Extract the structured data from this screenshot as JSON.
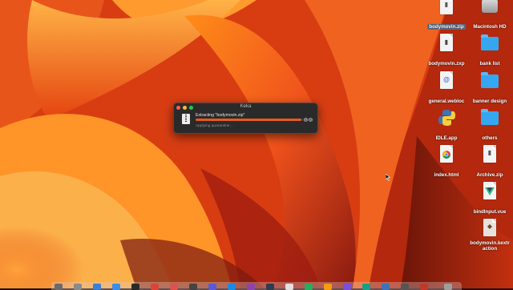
{
  "colors": {
    "accent": "#e85b1c",
    "window_bg": "#2a2a2b",
    "selection": "#5f6f86"
  },
  "desktop_icons": [
    {
      "label": "bodymovin.zip",
      "icon": "zip-archive-icon",
      "selected": true
    },
    {
      "label": "Macintosh HD",
      "icon": "hard-drive-icon"
    },
    {
      "label": "bodymovin.zxp",
      "icon": "document-icon"
    },
    {
      "label": "bank list",
      "icon": "folder-icon"
    },
    {
      "label": "general.webloc",
      "icon": "webloc-icon"
    },
    {
      "label": "banner design",
      "icon": "folder-icon"
    },
    {
      "label": "IDLE.app",
      "icon": "python-icon"
    },
    {
      "label": "others",
      "icon": "folder-icon"
    },
    {
      "label": "index.html",
      "icon": "chrome-document-icon"
    },
    {
      "label": "Archive.zip",
      "icon": "zip-archive-icon"
    },
    {
      "label": "bindInput.vue",
      "icon": "vue-document-icon"
    },
    {
      "label": "bodymovin.kextraction",
      "icon": "keka-extraction-icon"
    }
  ],
  "keka_window": {
    "title": "Keka",
    "message": "Extracting \"bodymovin.zip\"",
    "status": "Applying quarantine…",
    "progress": 0.9
  }
}
